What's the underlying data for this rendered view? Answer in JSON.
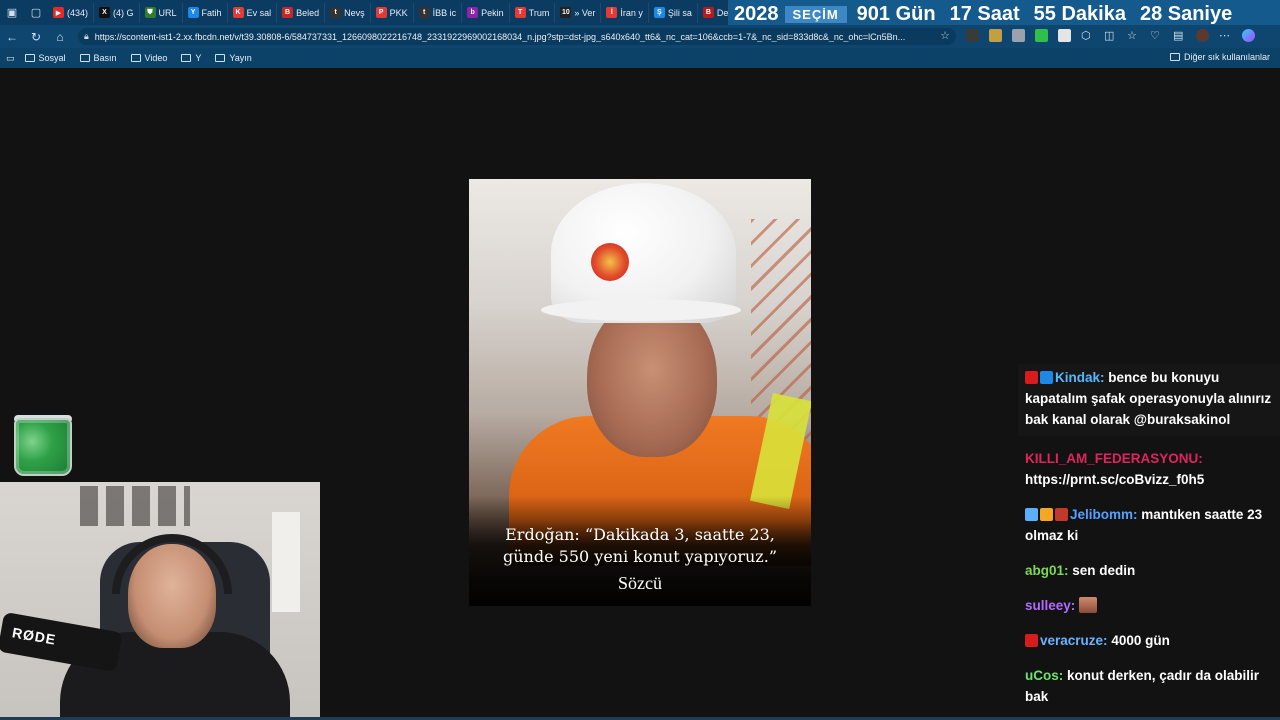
{
  "browser": {
    "tabs": [
      {
        "label": "(434)",
        "fav_color": "#e32b2b",
        "fav_glyph": "▶"
      },
      {
        "label": "(4) G",
        "fav_color": "#111111",
        "fav_glyph": "X"
      },
      {
        "label": "URL",
        "fav_color": "#2e7d32",
        "fav_glyph": "⛊"
      },
      {
        "label": "Fatih",
        "fav_color": "#1e88e5",
        "fav_glyph": "Y"
      },
      {
        "label": "Ev sal",
        "fav_color": "#e53935",
        "fav_glyph": "K"
      },
      {
        "label": "Beled",
        "fav_color": "#c62828",
        "fav_glyph": "B"
      },
      {
        "label": "Nevş",
        "fav_color": "#333333",
        "fav_glyph": "t"
      },
      {
        "label": "PKK",
        "fav_color": "#e53935",
        "fav_glyph": "P"
      },
      {
        "label": "İBB ic",
        "fav_color": "#333333",
        "fav_glyph": "t"
      },
      {
        "label": "Pekin",
        "fav_color": "#8e24aa",
        "fav_glyph": "b"
      },
      {
        "label": "Trum",
        "fav_color": "#e53935",
        "fav_glyph": "T"
      },
      {
        "label": "» Ver",
        "fav_color": "#222222",
        "fav_glyph": "10"
      },
      {
        "label": "İran y",
        "fav_color": "#e53935",
        "fav_glyph": "İ"
      },
      {
        "label": "Şili sa",
        "fav_color": "#1e88e5",
        "fav_glyph": "Ş"
      },
      {
        "label": "Dem",
        "fav_color": "#b71c1c",
        "fav_glyph": "B"
      },
      {
        "label": "",
        "fav_color": "#b71c1c",
        "fav_glyph": "B"
      }
    ],
    "countdown": {
      "year": "2028",
      "secim": "SEÇİM",
      "days": "901 Gün",
      "hours": "17 Saat",
      "minutes": "55 Dakika",
      "seconds": "28 Saniye"
    },
    "url": "https://scontent-ist1-2.xx.fbcdn.net/v/t39.30808-6/584737331_1266098022216748_2331922969002168034_n.jpg?stp=dst-jpg_s640x640_tt6&_nc_cat=106&ccb=1-7&_nc_sid=833d8c&_nc_ohc=lCn5Bn...",
    "bookmarks": [
      "Sosyal",
      "Basın",
      "Video",
      "Y",
      "Yayın"
    ],
    "other_bookmarks": "Diğer sık kullanılanlar"
  },
  "image": {
    "caption_line1": "Erdoğan: “Dakikada 3, saatte 23,",
    "caption_line2": "günde 550 yeni konut yapıyoruz.”",
    "brand": "Sözcü"
  },
  "chat": [
    {
      "user": "Kindak:",
      "user_color": "#53b8ff",
      "text": "bence bu konuyu kapatalım şafak operasyonuyla alınırız bak kanal olarak @buraksakinol",
      "highlight": true,
      "badges": [
        "#d81b1b",
        "#1e88e5"
      ]
    },
    {
      "user": "KILLI_AM_FEDERASYONU:",
      "user_color": "#e0245e",
      "text": "https://prnt.sc/coBvizz_f0h5",
      "highlight": false,
      "badges": []
    },
    {
      "user": "Jelibomm:",
      "user_color": "#56a0ff",
      "text": "mantıken saatte 23 olmaz ki",
      "highlight": false,
      "badges": [
        "#5ab0ff",
        "#f5a623",
        "#c0392b"
      ]
    },
    {
      "user": "abg01:",
      "user_color": "#7ed957",
      "text": "sen dedin",
      "highlight": false,
      "badges": []
    },
    {
      "user": "sulleey:",
      "user_color": "#b36bff",
      "text": "",
      "highlight": false,
      "badges": [],
      "emote": true
    },
    {
      "user": "veracruze:",
      "user_color": "#6bb2ff",
      "text": "4000 gün",
      "highlight": false,
      "badges": [
        "#d81b1b"
      ]
    },
    {
      "user": "uCos:",
      "user_color": "#6ee36e",
      "text": "konut derken, çadır da olabilir bak",
      "highlight": false,
      "badges": []
    }
  ]
}
